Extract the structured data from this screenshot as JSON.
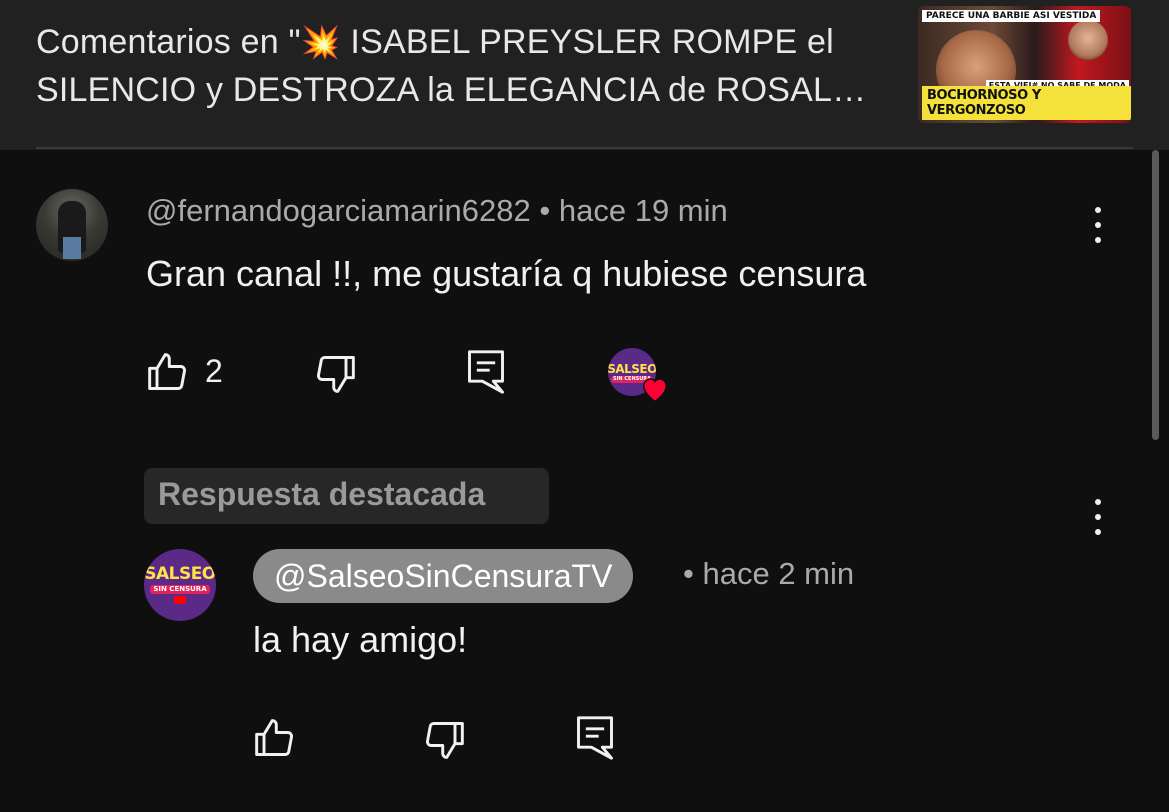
{
  "header": {
    "title_prefix": "Comentarios en \"",
    "title_line1_rest": " ISABEL PREYSLER ROMPE el",
    "title_line2": "SILENCIO y DESTROZA la ELEGANCIA de ROSAL…",
    "collision_emoji": "💥",
    "thumbnail": {
      "top_text": "PARECE UNA BARBIE ASI VESTIDA",
      "middle_text": "ESTA VIEJ# NO SABE DE MODA",
      "bottom_text": "BOCHORNOSO Y VERGONZOSO"
    }
  },
  "comment": {
    "author": "@fernandogarciamarin6282",
    "separator": "•",
    "time": "hace 19 min",
    "text": "Gran canal !!, me gustaría q hubiese censura",
    "likes": "2",
    "hearted_by_creator": true,
    "creator_badge_text": "SALSEO",
    "creator_badge_sub": "SIN CENSURA"
  },
  "reply": {
    "pinned_label": "Respuesta destacada",
    "author": "@SalseoSinCensuraTV",
    "separator": "•",
    "time": "hace 2 min",
    "text": "la hay amigo!",
    "avatar_text": "SALSEO",
    "avatar_sub": "SIN CENSURA"
  },
  "icons": {
    "like": "thumbs-up-icon",
    "dislike": "thumbs-down-icon",
    "reply": "reply-comment-icon",
    "more": "more-vertical-icon",
    "heart": "heart-icon"
  },
  "colors": {
    "background": "#0f0f0f",
    "header_background": "#212121",
    "primary_text": "#f1f1f1",
    "secondary_text": "#aaaaaa",
    "heart": "#ff0033",
    "author_chip": "#8a8a8a"
  }
}
